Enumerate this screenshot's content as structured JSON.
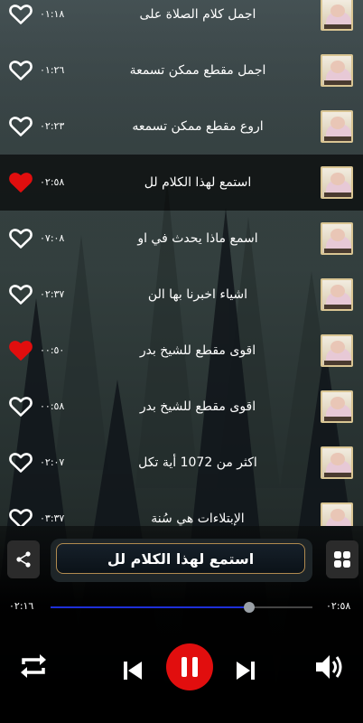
{
  "colors": {
    "accent_red": "#e10e0e",
    "progress_blue": "#1e2fd8",
    "frame_gold": "#b08a4f"
  },
  "tracks": [
    {
      "title": "اجمل كلام الصلاة على",
      "duration": "٠١:١٨",
      "favorite": false,
      "playing": false
    },
    {
      "title": "اجمل مقطع ممكن تسمعة",
      "duration": "٠١:٢٦",
      "favorite": false,
      "playing": false
    },
    {
      "title": "اروع مقطع ممكن تسمعه",
      "duration": "٠٢:٢٣",
      "favorite": false,
      "playing": false
    },
    {
      "title": "استمع لهذا الكلام لل",
      "duration": "٠٢:٥٨",
      "favorite": true,
      "playing": true
    },
    {
      "title": "اسمع ماذا يحدث في او",
      "duration": "٠٧:٠٨",
      "favorite": false,
      "playing": false
    },
    {
      "title": "اشياء اخبرنا بها الن",
      "duration": "٠٢:٣٧",
      "favorite": false,
      "playing": false
    },
    {
      "title": "اقوى مقطع للشيخ بدر",
      "duration": "٠٠:٥٠",
      "favorite": true,
      "playing": false
    },
    {
      "title": "اقوى مقطع للشيخ بدر",
      "duration": "٠٠:٥٨",
      "favorite": false,
      "playing": false
    },
    {
      "title": "اكثر من 1072 أية تكل",
      "duration": "٠٢:٠٧",
      "favorite": false,
      "playing": false
    },
    {
      "title": "الإبتلاءات هي سُنة",
      "duration": "٠٣:٣٧",
      "favorite": false,
      "playing": false
    }
  ],
  "player": {
    "now_playing": "استمع لهذا الكلام لل",
    "elapsed": "٠٢:١٦",
    "total": "٠٢:٥٨",
    "progress": 0.76,
    "state": "playing"
  },
  "icons": {
    "share": "share-icon",
    "grid": "grid-icon",
    "repeat": "repeat-icon",
    "previous": "skip-previous-icon",
    "pause": "pause-icon",
    "next": "skip-next-icon",
    "volume": "volume-icon"
  }
}
